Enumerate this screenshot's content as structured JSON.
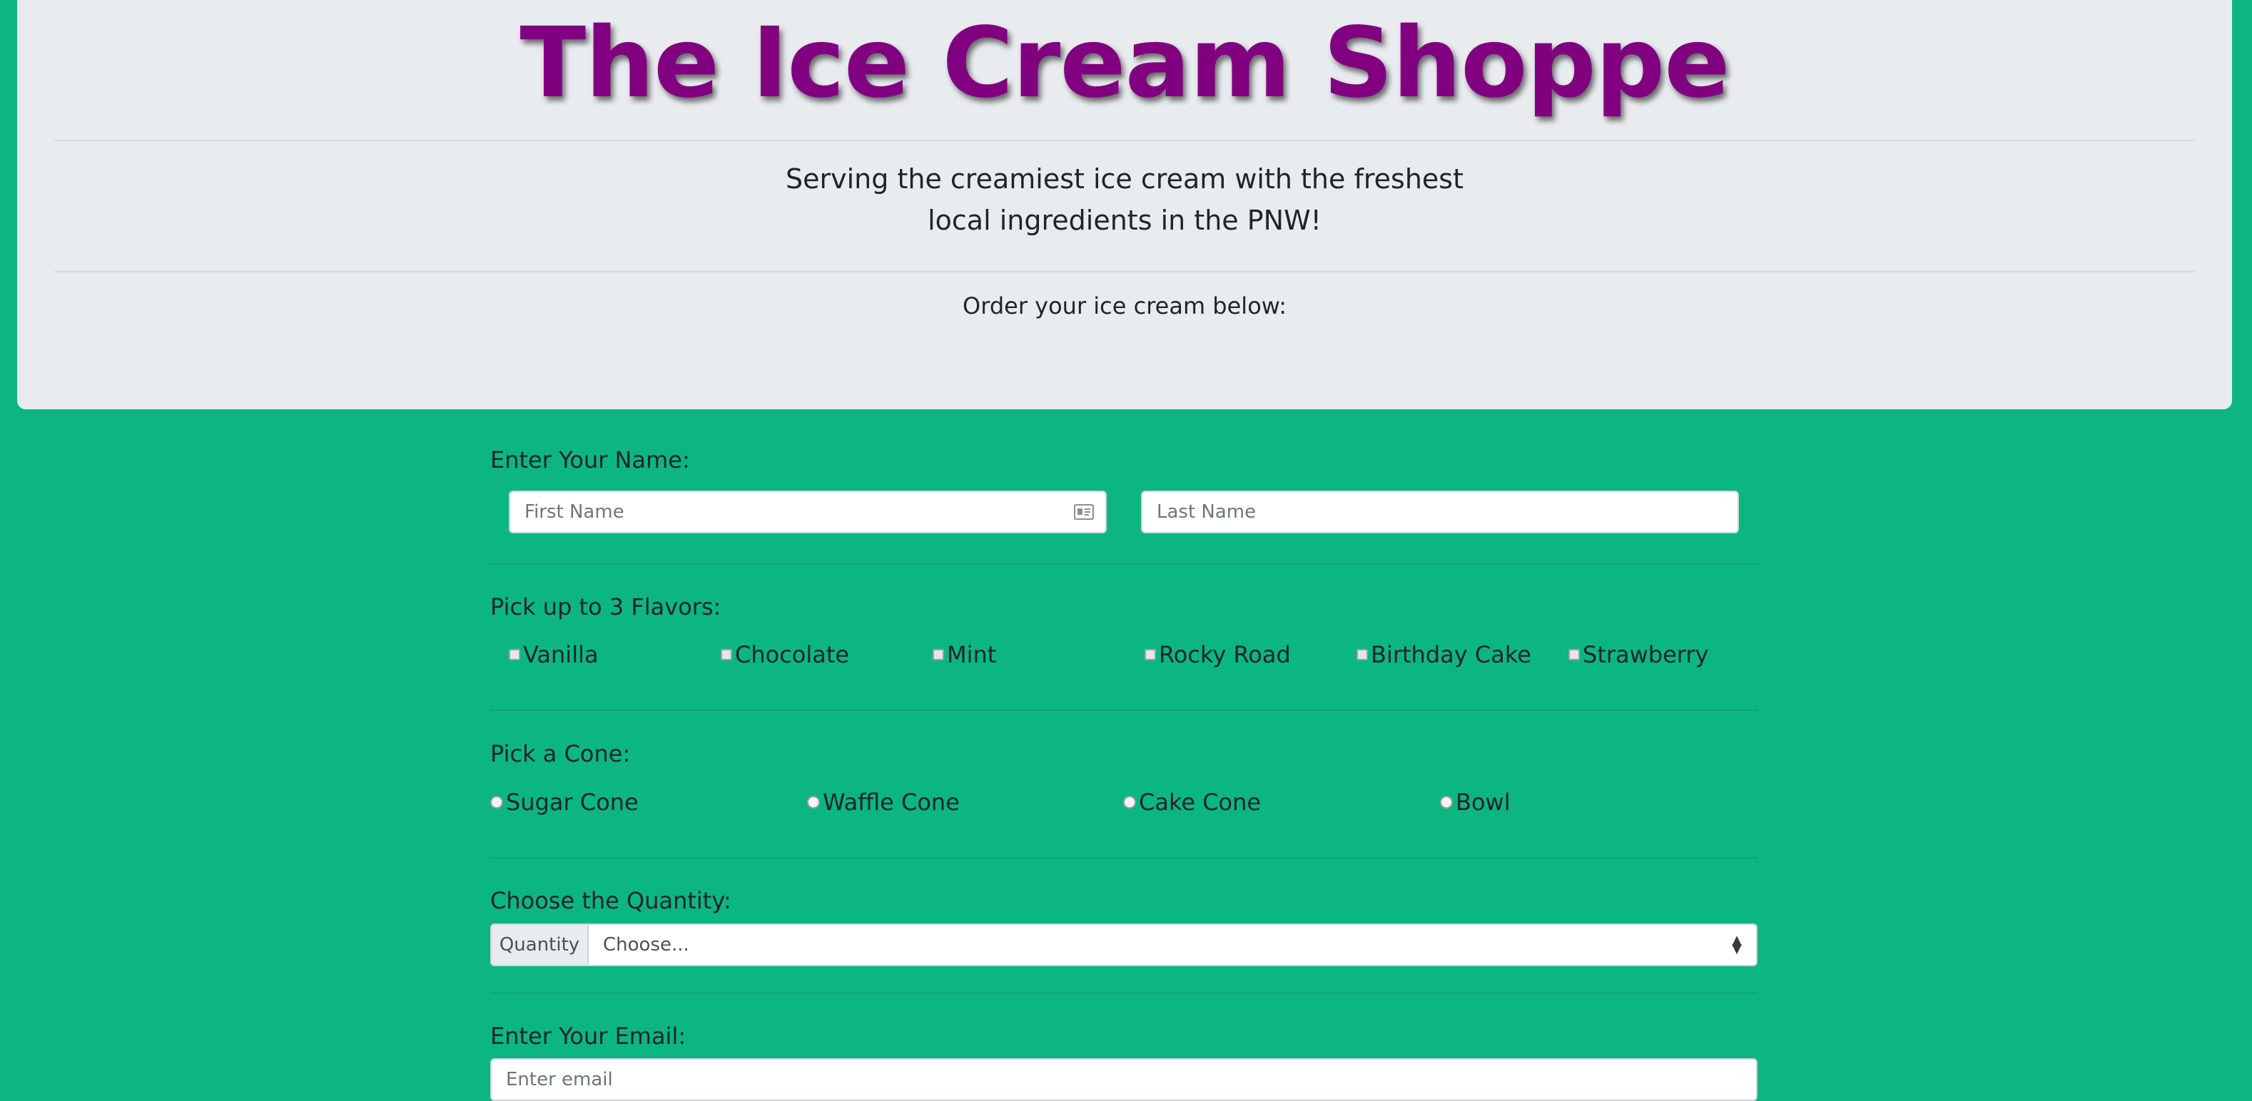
{
  "header": {
    "title": "The Ice Cream Shoppe",
    "tagline_line1": "Serving the creamiest ice cream with the freshest",
    "tagline_line2": "local ingredients in the PNW!",
    "order_prompt": "Order your ice cream below:"
  },
  "name_section": {
    "label": "Enter Your Name:",
    "first_placeholder": "First Name",
    "last_placeholder": "Last Name"
  },
  "flavors_section": {
    "label": "Pick up to 3 Flavors:",
    "options": [
      "Vanilla",
      "Chocolate",
      "Mint",
      "Rocky Road",
      "Birthday Cake",
      "Strawberry"
    ]
  },
  "cone_section": {
    "label": "Pick a Cone:",
    "options": [
      "Sugar Cone",
      "Waffle Cone",
      "Cake Cone",
      "Bowl"
    ]
  },
  "quantity_section": {
    "label": "Choose the Quantity:",
    "prepend": "Quantity",
    "selected": "Choose..."
  },
  "email_section": {
    "label": "Enter Your Email:",
    "placeholder": "Enter email"
  },
  "colors": {
    "background": "#0cb680",
    "title": "#800080",
    "jumbotron": "#e9ecef"
  }
}
